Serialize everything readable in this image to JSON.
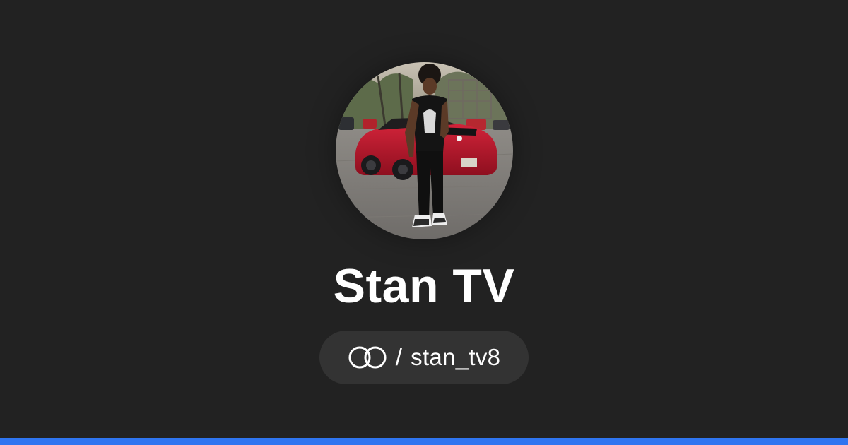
{
  "profile": {
    "name": "Stan TV",
    "separator": "/",
    "handle": "stan_tv8",
    "logo_icon": "linked-rings-icon",
    "avatar_icon": "profile-photo"
  },
  "colors": {
    "background": "#222222",
    "pill": "#333333",
    "text": "#ffffff",
    "accent": "#2f75f0"
  }
}
